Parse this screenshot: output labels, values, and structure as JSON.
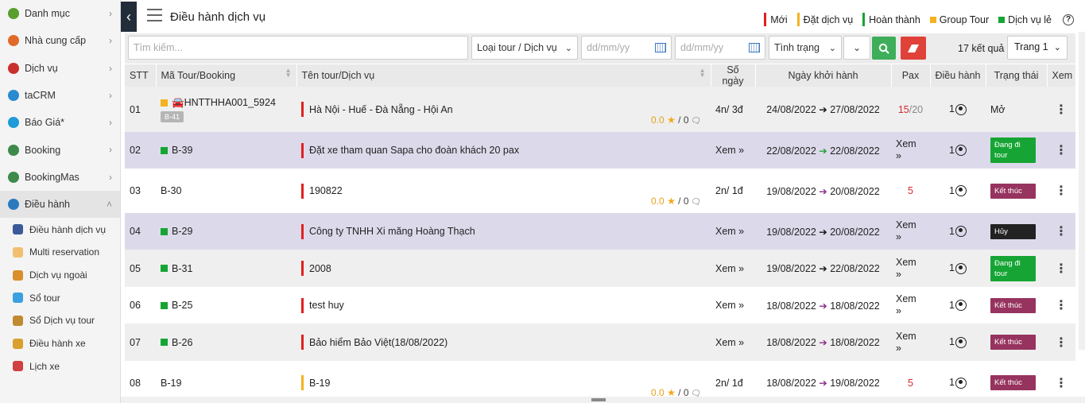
{
  "sidebar": {
    "items": [
      {
        "label": "Danh mục",
        "color": "#5a9e2e"
      },
      {
        "label": "Nhà cung cấp",
        "color": "#e06a2a"
      },
      {
        "label": "Dịch vụ",
        "color": "#c9302c"
      },
      {
        "label": "taCRM",
        "color": "#2a8ad0"
      },
      {
        "label": "Báo Giá*",
        "color": "#1e9bd8"
      },
      {
        "label": "Booking",
        "color": "#3d8a4a"
      },
      {
        "label": "BookingMas",
        "color": "#3d8a4a"
      },
      {
        "label": "Điều hành",
        "color": "#2a7ac0"
      }
    ],
    "sub_items": [
      {
        "label": "Điều hành dịch vụ",
        "color": "#3b5998"
      },
      {
        "label": "Multi reservation",
        "color": "#f0c070"
      },
      {
        "label": "Dịch vụ ngoài",
        "color": "#d98f2b"
      },
      {
        "label": "Sổ tour",
        "color": "#3ba0e0"
      },
      {
        "label": "Sổ Dịch vụ tour",
        "color": "#c08a30"
      },
      {
        "label": "Điều hành xe",
        "color": "#d9a030"
      },
      {
        "label": "Lịch xe",
        "color": "#d04040"
      }
    ]
  },
  "header": {
    "title": "Điều hành dịch vụ",
    "legend": [
      {
        "label": "Mới",
        "color": "#e02020",
        "shape": "bar"
      },
      {
        "label": "Đặt dịch vụ",
        "color": "#f3b21f",
        "shape": "bar"
      },
      {
        "label": "Hoàn thành",
        "color": "#16a534",
        "shape": "bar"
      },
      {
        "label": "Group Tour",
        "color": "#f3b21f",
        "shape": "square"
      },
      {
        "label": "Dịch vụ lẻ",
        "color": "#16a534",
        "shape": "square"
      }
    ],
    "help": "?"
  },
  "filter": {
    "search_placeholder": "Tìm kiếm...",
    "type_select": "Loại tour / Dịch vụ",
    "date_from_placeholder": "dd/mm/yy",
    "date_to_placeholder": "dd/mm/yy",
    "status_select": "Tình trạng",
    "result_count": "17 kết quả",
    "page_select": "Trang 1"
  },
  "table": {
    "headers": [
      "STT",
      "Mã Tour/Booking",
      "Tên tour/Dịch vụ",
      "Số ngày",
      "Ngày khởi hành",
      "Pax",
      "Điều hành",
      "Trạng thái",
      "Xem"
    ],
    "rows": [
      {
        "stt": "01",
        "code": "🚘HNTTHHA001_5924",
        "code_sq": "#f3b21f",
        "sub": "B-41",
        "name": "Hà Nội - Huế - Đà Nẵng - Hội An",
        "name_bar": "#e02020",
        "rating": "0.0",
        "reviews": "/ 0",
        "days": "4n/ 3đ",
        "from": "24/08/2022",
        "to": "27/08/2022",
        "arrow": "black",
        "pax_a": "15",
        "pax_b": "/20",
        "op": "1",
        "status": "Mở",
        "status_type": "text",
        "bg": "grey"
      },
      {
        "stt": "02",
        "code": "B-39",
        "code_sq": "#16a534",
        "sub": "",
        "name": "Đặt xe tham quan Sapa cho đoàn khách 20 pax",
        "name_bar": "#e02020",
        "rating": "",
        "reviews": "",
        "days": "Xem »",
        "from": "22/08/2022",
        "to": "22/08/2022",
        "arrow": "green",
        "pax_a": "",
        "pax_b": "Xem »",
        "op": "1",
        "status": "Đang đi tour",
        "status_type": "going",
        "bg": "purple"
      },
      {
        "stt": "03",
        "code": "B-30",
        "code_sq": "",
        "sub": "",
        "name": "190822",
        "name_bar": "#e02020",
        "rating": "0.0",
        "reviews": "/ 0",
        "days": "2n/ 1đ",
        "from": "19/08/2022",
        "to": "20/08/2022",
        "arrow": "purple",
        "pax_a": "5",
        "pax_b": "",
        "op": "1",
        "status": "Kết thúc",
        "status_type": "done",
        "bg": "white"
      },
      {
        "stt": "04",
        "code": "B-29",
        "code_sq": "#16a534",
        "sub": "",
        "name": "Công ty TNHH Xi măng Hoàng Thạch",
        "name_bar": "#e02020",
        "rating": "",
        "reviews": "",
        "days": "Xem »",
        "from": "19/08/2022",
        "to": "20/08/2022",
        "arrow": "black",
        "pax_a": "",
        "pax_b": "Xem »",
        "op": "1",
        "status": "Hủy",
        "status_type": "cancel",
        "bg": "purple"
      },
      {
        "stt": "05",
        "code": "B-31",
        "code_sq": "#16a534",
        "sub": "",
        "name": "2008",
        "name_bar": "#e02020",
        "rating": "",
        "reviews": "",
        "days": "Xem »",
        "from": "19/08/2022",
        "to": "22/08/2022",
        "arrow": "black",
        "pax_a": "",
        "pax_b": "Xem »",
        "op": "1",
        "status": "Đang đi tour",
        "status_type": "going",
        "bg": "grey"
      },
      {
        "stt": "06",
        "code": "B-25",
        "code_sq": "#16a534",
        "sub": "",
        "name": "test huy",
        "name_bar": "#e02020",
        "rating": "",
        "reviews": "",
        "days": "Xem »",
        "from": "18/08/2022",
        "to": "18/08/2022",
        "arrow": "purple",
        "pax_a": "",
        "pax_b": "Xem »",
        "op": "1",
        "status": "Kết thúc",
        "status_type": "done",
        "bg": "white"
      },
      {
        "stt": "07",
        "code": "B-26",
        "code_sq": "#16a534",
        "sub": "",
        "name": "Bảo hiểm Bảo Việt(18/08/2022)",
        "name_bar": "#e02020",
        "rating": "",
        "reviews": "",
        "days": "Xem »",
        "from": "18/08/2022",
        "to": "18/08/2022",
        "arrow": "purple",
        "pax_a": "",
        "pax_b": "Xem »",
        "op": "1",
        "status": "Kết thúc",
        "status_type": "done",
        "bg": "grey"
      },
      {
        "stt": "08",
        "code": "B-19",
        "code_sq": "",
        "sub": "",
        "name": "B-19",
        "name_bar": "#f3b21f",
        "rating": "0.0",
        "reviews": "/ 0",
        "days": "2n/ 1đ",
        "from": "18/08/2022",
        "to": "19/08/2022",
        "arrow": "purple",
        "pax_a": "5",
        "pax_b": "",
        "op": "1",
        "status": "Kết thúc",
        "status_type": "done",
        "bg": "white"
      }
    ]
  }
}
